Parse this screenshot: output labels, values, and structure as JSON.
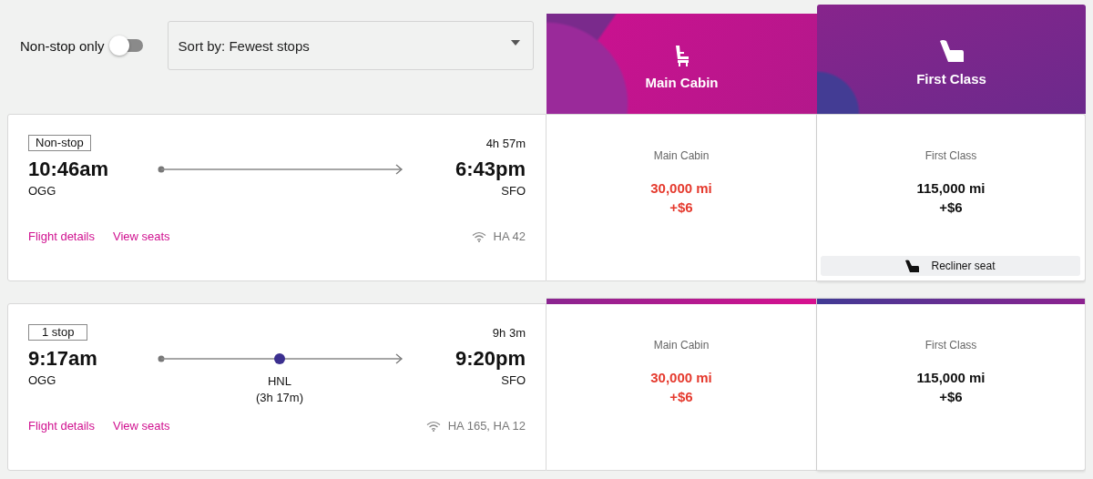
{
  "filters": {
    "nonstop_toggle": {
      "label": "Non-stop only",
      "on": false
    },
    "sort": {
      "value": "Sort by: Fewest stops"
    }
  },
  "cabins": [
    {
      "name": "Main Cabin",
      "kind": "main",
      "selected": false
    },
    {
      "name": "First Class",
      "kind": "first",
      "selected": true
    }
  ],
  "flights": [
    {
      "stops_badge": "Non-stop",
      "duration": "4h 57m",
      "depart_time": "10:46am",
      "depart_airport": "OGG",
      "arrive_time": "6:43pm",
      "arrive_airport": "SFO",
      "links": [
        "Flight details",
        "View seats"
      ],
      "flight_numbers": "HA 42",
      "fares": [
        {
          "cabin": "Main Cabin",
          "miles": "30,000 mi",
          "fee": "+$6",
          "highlighted": true
        },
        {
          "cabin": "First Class",
          "miles": "115,000 mi",
          "fee": "+$6",
          "highlighted": false,
          "seat_note": "Recliner seat"
        }
      ]
    },
    {
      "stops_badge": "1 stop",
      "duration": "9h 3m",
      "depart_time": "9:17am",
      "depart_airport": "OGG",
      "arrive_time": "9:20pm",
      "arrive_airport": "SFO",
      "layovers": [
        {
          "airport": "HNL",
          "duration": "(3h 17m)"
        }
      ],
      "links": [
        "Flight details",
        "View seats"
      ],
      "flight_numbers": "HA 165, HA 12",
      "fares": [
        {
          "cabin": "Main Cabin",
          "miles": "30,000 mi",
          "fee": "+$6",
          "highlighted": true
        },
        {
          "cabin": "First Class",
          "miles": "115,000 mi",
          "fee": "+$6",
          "highlighted": false
        }
      ]
    }
  ]
}
